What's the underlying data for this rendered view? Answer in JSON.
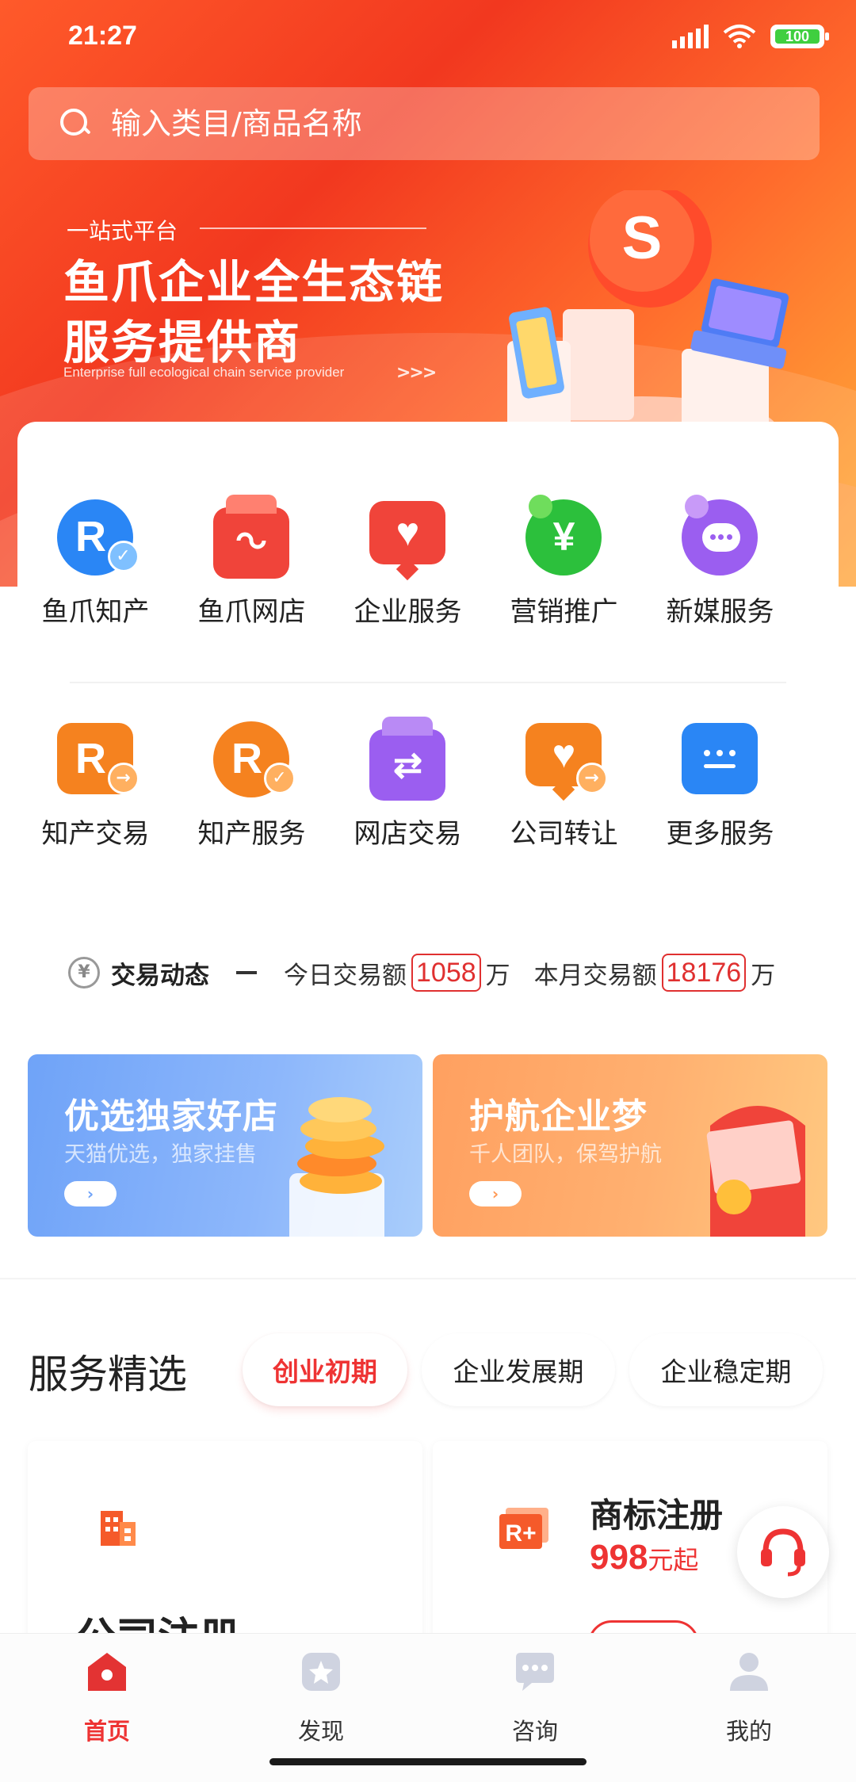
{
  "status_bar": {
    "time": "21:27",
    "battery": "100"
  },
  "search": {
    "placeholder": "输入类目/商品名称"
  },
  "hero": {
    "tag": "一站式平台",
    "title_line1": "鱼爪企业全生态链",
    "title_line2": "服务提供商",
    "subtitle": "Enterprise full ecological chain service provider",
    "arrows": ">>>"
  },
  "services_row1": [
    {
      "label": "鱼爪知产",
      "icon": "r-trademark-check-icon",
      "color": "#2a86f5"
    },
    {
      "label": "鱼爪网店",
      "icon": "shop-bag-icon",
      "color": "#f0443a"
    },
    {
      "label": "企业服务",
      "icon": "heart-message-icon",
      "color": "#f0443a"
    },
    {
      "label": "营销推广",
      "icon": "yen-bubble-icon",
      "color": "#2cc03c"
    },
    {
      "label": "新媒服务",
      "icon": "chat-bubble-icon",
      "color": "#9b5ef0"
    }
  ],
  "services_row2": [
    {
      "label": "知产交易",
      "icon": "r-transfer-icon",
      "color": "#f5821f"
    },
    {
      "label": "知产服务",
      "icon": "r-service-check-icon",
      "color": "#f5821f"
    },
    {
      "label": "网店交易",
      "icon": "shop-exchange-icon",
      "color": "#9b5ef0"
    },
    {
      "label": "公司转让",
      "icon": "heart-transfer-icon",
      "color": "#f5821f"
    },
    {
      "label": "更多服务",
      "icon": "more-dots-icon",
      "color": "#2a86f5"
    }
  ],
  "ticker": {
    "title": "交易动态",
    "today_label": "今日交易额",
    "today_value": "1058",
    "today_unit": "万",
    "month_label": "本月交易额",
    "month_value": "18176",
    "month_unit": "万"
  },
  "promos": [
    {
      "title": "优选独家好店",
      "subtitle": "天猫优选，独家挂售",
      "button": "›"
    },
    {
      "title": "护航企业梦",
      "subtitle": "千人团队，保驾护航",
      "button": "›"
    }
  ],
  "selection": {
    "title": "服务精选",
    "tabs": [
      "创业初期",
      "企业发展期",
      "企业稳定期"
    ],
    "active_tab": "创业初期"
  },
  "products": [
    {
      "name": "公司注册",
      "icon": "building-icon"
    },
    {
      "name": "商标注册",
      "price": "998",
      "price_unit": "元起",
      "icon": "r-plus-icon"
    }
  ],
  "bottom_nav": [
    {
      "label": "首页",
      "icon": "home-icon",
      "active": true
    },
    {
      "label": "发现",
      "icon": "discover-star-icon",
      "active": false
    },
    {
      "label": "咨询",
      "icon": "consult-chat-icon",
      "active": false
    },
    {
      "label": "我的",
      "icon": "profile-icon",
      "active": false
    }
  ],
  "colors": {
    "brand_red": "#e33333",
    "accent_orange": "#ff6a2c"
  }
}
